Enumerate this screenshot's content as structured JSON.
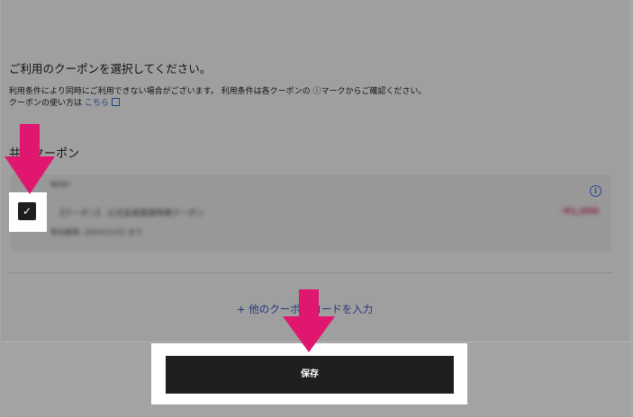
{
  "dialog": {
    "title": "ご利用のクーポンを選択してください。",
    "notice_line1": "利用条件により同時にご利用できない場合がございます。 利用条件は各クーポンの ⓘマークからご確認ください。",
    "notice_line2_prefix": "クーポンの使い方は ",
    "notice_link": "こちら"
  },
  "section": {
    "title": "共通クーポン"
  },
  "coupon": {
    "label": "NEW!",
    "name": "【クーポン】 公式会員登録特典クーポン",
    "expiry": "有効期限: 2023/12/31 まで",
    "amount": "-¥1,000",
    "selected": true,
    "check_glyph": "✓",
    "info_glyph": "i"
  },
  "actions": {
    "enter_code": "+ 他のクーポンコードを入力",
    "save_label": "保存"
  },
  "colors": {
    "annotation_arrow": "#e0176f",
    "link": "#26408a",
    "button": "#1f1f1f"
  }
}
